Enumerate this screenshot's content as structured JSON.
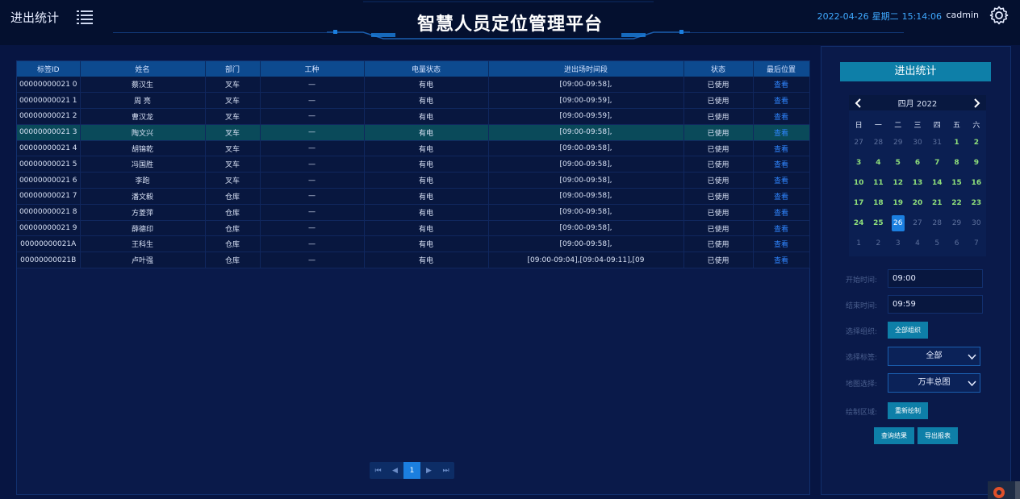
{
  "header": {
    "page_title": "进出统计",
    "platform_title": "智慧人员定位管理平台",
    "date": "2022-04-26",
    "weekday": "星期二",
    "time": "15:14:06",
    "user": "cadmin"
  },
  "table": {
    "columns": [
      "标签ID",
      "姓名",
      "部门",
      "工种",
      "电量状态",
      "进出场时间段",
      "状态",
      "最后位置"
    ],
    "rows": [
      [
        "00000000021 0",
        "蔡汉生",
        "叉车",
        "—",
        "有电",
        "[09:00-09:58],",
        "已使用",
        "查看"
      ],
      [
        "00000000021 1",
        "周 亮",
        "叉车",
        "—",
        "有电",
        "[09:00-09:59],",
        "已使用",
        "查看"
      ],
      [
        "00000000021 2",
        "曹汉龙",
        "叉车",
        "—",
        "有电",
        "[09:00-09:59],",
        "已使用",
        "查看"
      ],
      [
        "00000000021 3",
        "陶文兴",
        "叉车",
        "—",
        "有电",
        "[09:00-09:58],",
        "已使用",
        "查看"
      ],
      [
        "00000000021 4",
        "胡锦乾",
        "叉车",
        "—",
        "有电",
        "[09:00-09:58],",
        "已使用",
        "查看"
      ],
      [
        "00000000021 5",
        "冯国胜",
        "叉车",
        "—",
        "有电",
        "[09:00-09:58],",
        "已使用",
        "查看"
      ],
      [
        "00000000021 6",
        "李跑",
        "叉车",
        "—",
        "有电",
        "[09:00-09:58],",
        "已使用",
        "查看"
      ],
      [
        "00000000021 7",
        "潘文毅",
        "仓库",
        "—",
        "有电",
        "[09:00-09:58],",
        "已使用",
        "查看"
      ],
      [
        "00000000021 8",
        "方菱萍",
        "仓库",
        "—",
        "有电",
        "[09:00-09:58],",
        "已使用",
        "查看"
      ],
      [
        "00000000021 9",
        "薛德印",
        "仓库",
        "—",
        "有电",
        "[09:00-09:58],",
        "已使用",
        "查看"
      ],
      [
        "00000000021A",
        "王科生",
        "仓库",
        "—",
        "有电",
        "[09:00-09:58],",
        "已使用",
        "查看"
      ],
      [
        "00000000021B",
        "卢叶强",
        "仓库",
        "—",
        "有电",
        "[09:00-09:04],[09:04-09:11],[09",
        "已使用",
        "查看"
      ]
    ],
    "highlight_row": 3
  },
  "pager": {
    "current": "1"
  },
  "side": {
    "title": "进出统计",
    "calendar": {
      "month_label": "四月 2022",
      "weekdays": [
        "日",
        "一",
        "二",
        "三",
        "四",
        "五",
        "六"
      ],
      "weeks": [
        [
          "27",
          "28",
          "29",
          "30",
          "31",
          "1",
          "2"
        ],
        [
          "3",
          "4",
          "5",
          "6",
          "7",
          "8",
          "9"
        ],
        [
          "10",
          "11",
          "12",
          "13",
          "14",
          "15",
          "16"
        ],
        [
          "17",
          "18",
          "19",
          "20",
          "21",
          "22",
          "23"
        ],
        [
          "24",
          "25",
          "26",
          "27",
          "28",
          "29",
          "30"
        ],
        [
          "1",
          "2",
          "3",
          "4",
          "5",
          "6",
          "7"
        ]
      ],
      "selected": "26"
    },
    "start_label": "开始时间:",
    "start_value": "09:00",
    "end_label": "结束时间:",
    "end_value": "09:59",
    "org_label": "选择组织:",
    "org_button": "全部组织",
    "tag_label": "选择标签:",
    "tag_value": "全部",
    "map_label": "地图选择:",
    "map_value": "万丰总图",
    "area_label": "绘制区域:",
    "area_button": "重新绘制",
    "query_button": "查询结果",
    "export_button": "导出报表"
  },
  "colors": {
    "accent": "#0e7fa8",
    "link": "#2f86ff",
    "highlight": "#0a4a5a",
    "datetime": "#3fa9ff"
  }
}
